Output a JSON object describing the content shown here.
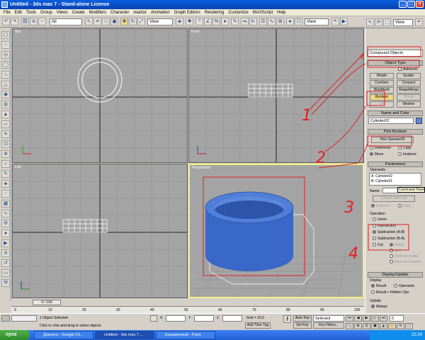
{
  "title": "Untitled   - 3ds max 7   - Stand-alone License",
  "menu": [
    "File",
    "Edit",
    "Tools",
    "Group",
    "Views",
    "Create",
    "Modifiers",
    "Character",
    "reactor",
    "Animation",
    "Graph Editors",
    "Rendering",
    "Customize",
    "MAXScript",
    "Help"
  ],
  "toolbar": {
    "selection_filter": "All",
    "ref_coord": "View",
    "ref_coord2": "View"
  },
  "viewports": {
    "top": "Top",
    "front": "Front",
    "left": "Left",
    "perspective": "Perspective"
  },
  "panel": {
    "category": "Compound Objects",
    "object_type_header": "Object Type",
    "autogrid": "AutoGrid",
    "buttons": [
      "Morph",
      "Scatter",
      "Conform",
      "Connect",
      "BlobMesh",
      "ShapeMerge",
      "Boolean",
      "Terrain",
      "Loft",
      "Mesher"
    ],
    "name_color_header": "Name and Color",
    "object_name": "Cylinder02",
    "pick_boolean_header": "Pick Boolean",
    "pick_operand": "Pick Operand B",
    "pick_opts": [
      "Reference",
      "Copy",
      "Move",
      "Instance"
    ],
    "parameters_header": "Parameters",
    "operands_label": "Operands",
    "operands": [
      "A: Cylinder02",
      "B: Cylinder01"
    ],
    "name_label": "Name:",
    "tooltip": "Command Panel",
    "extract": "Extract Operand",
    "extract_opts": [
      "Instance",
      "Copy"
    ],
    "operation_label": "Operation",
    "operations": [
      "Union",
      "Intersection",
      "Subtraction (A-B)",
      "Subtraction (B-A)",
      "Cut"
    ],
    "cut_opts": [
      "Refine",
      "Split",
      "Remove Inside",
      "Remove Outside"
    ],
    "display_update_header": "Display/Update",
    "display_label": "Display",
    "display_opts": [
      "Result",
      "Operands",
      "Result + Hidden Ops"
    ],
    "update_label": "Update",
    "update_opts": [
      "Always"
    ]
  },
  "annotations": [
    "1",
    "2",
    "3",
    "4"
  ],
  "timeline": {
    "slider": "0 / 100",
    "ticks": [
      "0",
      "10",
      "20",
      "30",
      "40",
      "50",
      "60",
      "70",
      "80",
      "90",
      "100"
    ]
  },
  "status": {
    "selected": "1 Object Selected",
    "prompt": "Click or click-and-drag to select objects",
    "x_label": "X",
    "y_label": "Y",
    "z_label": "Z",
    "grid": "Grid = 10,0",
    "add_time_tag": "Add Time Tag",
    "auto_key": "Auto Key",
    "set_key": "Set Key",
    "key_mode": "Selected",
    "key_filters": "Key Filters...",
    "frame": "0"
  },
  "taskbar": {
    "start": "пуск",
    "items": [
      "Диалоги - Google Ch...",
      "Untitled - 3ds max 7 ...",
      "Безымянный - Paint"
    ],
    "lang": "EN",
    "clock": "22:24"
  },
  "colors": {
    "annotation": "#e02020",
    "object": "#3a68c8",
    "viewport_bg": "#a4a4a4"
  }
}
